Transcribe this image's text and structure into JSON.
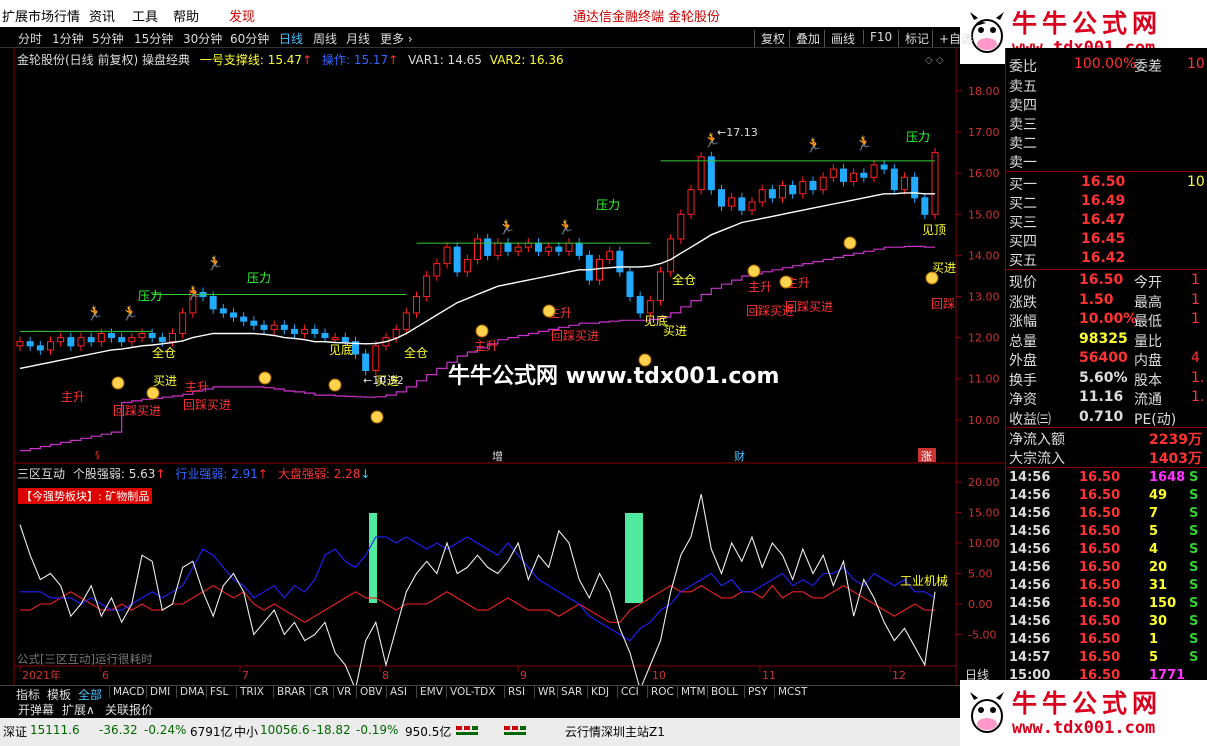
{
  "menu": {
    "items": [
      "扩展市场行情",
      "资讯",
      "工具",
      "帮助",
      "发现"
    ],
    "center1": "通达信金融终端",
    "center2": "金轮股份"
  },
  "logo": {
    "title": "牛牛公式网",
    "url": "www.tdx001.com"
  },
  "toolbar": {
    "periods": [
      "分时",
      "1分钟",
      "5分钟",
      "15分钟",
      "30分钟",
      "日线",
      "周线",
      "月线",
      "更多 ›"
    ],
    "active": "日线",
    "buttons": [
      "复权",
      "叠加",
      "画线",
      "F10",
      "标记",
      "+自选"
    ]
  },
  "main_header": {
    "title": "金轮股份(日线 前复权) 操盘经典",
    "support_label": "一号支撑线:",
    "support_value": "15.47",
    "op_label": "操作:",
    "op_value": "15.17",
    "var1": "VAR1: 14.65",
    "var2": "VAR2: 16.36"
  },
  "sub_header": {
    "title": "三区互动",
    "s1_label": "个股强弱:",
    "s1_value": "5.63",
    "s2_label": "行业强弱:",
    "s2_value": "2.91",
    "s3_label": "大盘强弱:",
    "s3_value": "2.28",
    "badge": "【今强势板块】: 矿物制品",
    "footer_note": "公式[三区互动]运行很耗时",
    "sector_label": "工业机械"
  },
  "watermark": "牛牛公式网 www.tdx001.com",
  "price_axis": [
    "18.00",
    "17.00",
    "16.00",
    "15.00",
    "14.00",
    "13.00",
    "12.00",
    "11.00",
    "10.00"
  ],
  "osc_axis": [
    "20.00",
    "15.00",
    "10.00",
    "5.00",
    "0.00",
    "-5.00"
  ],
  "time_axis": [
    "2021年",
    "6",
    "7",
    "8",
    "9",
    "10",
    "11",
    "12"
  ],
  "period_tag": "日线",
  "markers": {
    "zeng": "增",
    "cai": "财",
    "zhang": "涨",
    "peak": "17.13",
    "low": "10.52"
  },
  "chart_labels": [
    {
      "t": "压力",
      "c": "#3f3"
    },
    {
      "t": "压力",
      "c": "#3f3"
    },
    {
      "t": "压力",
      "c": "#3f3"
    },
    {
      "t": "压力",
      "c": "#3f3"
    },
    {
      "t": "全仓",
      "c": "#ff3"
    },
    {
      "t": "全仓",
      "c": "#ff3"
    },
    {
      "t": "全仓",
      "c": "#ff3"
    },
    {
      "t": "见底",
      "c": "#ff3"
    },
    {
      "t": "见底",
      "c": "#ff3"
    },
    {
      "t": "买进",
      "c": "#ff3"
    },
    {
      "t": "买进",
      "c": "#ff3"
    },
    {
      "t": "买进",
      "c": "#ff3"
    },
    {
      "t": "买进",
      "c": "#ff3"
    },
    {
      "t": "主升",
      "c": "#f33"
    },
    {
      "t": "主升",
      "c": "#f33"
    },
    {
      "t": "主升",
      "c": "#f33"
    },
    {
      "t": "主升",
      "c": "#f33"
    },
    {
      "t": "主升",
      "c": "#f33"
    },
    {
      "t": "主升",
      "c": "#f33"
    },
    {
      "t": "回踩买进",
      "c": "#f33"
    },
    {
      "t": "回踩买进",
      "c": "#f33"
    },
    {
      "t": "回踩买进",
      "c": "#f33"
    },
    {
      "t": "回踩买进",
      "c": "#f33"
    },
    {
      "t": "回踩买进",
      "c": "#f33"
    },
    {
      "t": "回踩",
      "c": "#f33"
    },
    {
      "t": "见顶",
      "c": "#ff3"
    }
  ],
  "quote": {
    "top": {
      "a": "委比",
      "b": "100.00%",
      "c": "委差",
      "d": "10"
    },
    "sells": [
      "卖五",
      "卖四",
      "卖三",
      "卖二",
      "卖一"
    ],
    "buys": [
      {
        "n": "买一",
        "p": "16.50",
        "v": "10"
      },
      {
        "n": "买二",
        "p": "16.49",
        "v": ""
      },
      {
        "n": "买三",
        "p": "16.47",
        "v": ""
      },
      {
        "n": "买四",
        "p": "16.45",
        "v": ""
      },
      {
        "n": "买五",
        "p": "16.42",
        "v": ""
      }
    ],
    "stats": [
      {
        "a": "现价",
        "b": "16.50",
        "c": "今开",
        "d": "1",
        "bc": "#f33"
      },
      {
        "a": "涨跌",
        "b": "1.50",
        "c": "最高",
        "d": "1",
        "bc": "#f33"
      },
      {
        "a": "涨幅",
        "b": "10.00%",
        "c": "最低",
        "d": "1",
        "bc": "#f33"
      },
      {
        "a": "总量",
        "b": "98325",
        "c": "量比",
        "d": "",
        "bc": "#ff3"
      },
      {
        "a": "外盘",
        "b": "56400",
        "c": "内盘",
        "d": "4",
        "bc": "#f33"
      },
      {
        "a": "换手",
        "b": "5.60%",
        "c": "股本",
        "d": "1.",
        "bc": "#ddd"
      },
      {
        "a": "净资",
        "b": "11.16",
        "c": "流通",
        "d": "1.",
        "bc": "#ddd"
      },
      {
        "a": "收益㈢",
        "b": "0.710",
        "c": "PE(动)",
        "d": "",
        "bc": "#ddd"
      }
    ],
    "flow": [
      {
        "a": "净流入额",
        "b": "2239万"
      },
      {
        "a": "大宗流入",
        "b": "1403万"
      }
    ],
    "ticks": [
      {
        "t": "14:56",
        "p": "16.50",
        "v": "1648",
        "s": "S",
        "vc": "#f3f"
      },
      {
        "t": "14:56",
        "p": "16.50",
        "v": "49",
        "s": "S",
        "vc": "#ff3"
      },
      {
        "t": "14:56",
        "p": "16.50",
        "v": "7",
        "s": "S",
        "vc": "#ff3"
      },
      {
        "t": "14:56",
        "p": "16.50",
        "v": "5",
        "s": "S",
        "vc": "#ff3"
      },
      {
        "t": "14:56",
        "p": "16.50",
        "v": "4",
        "s": "S",
        "vc": "#ff3"
      },
      {
        "t": "14:56",
        "p": "16.50",
        "v": "20",
        "s": "S",
        "vc": "#ff3"
      },
      {
        "t": "14:56",
        "p": "16.50",
        "v": "31",
        "s": "S",
        "vc": "#ff3"
      },
      {
        "t": "14:56",
        "p": "16.50",
        "v": "150",
        "s": "S",
        "vc": "#ff3"
      },
      {
        "t": "14:56",
        "p": "16.50",
        "v": "30",
        "s": "S",
        "vc": "#ff3"
      },
      {
        "t": "14:56",
        "p": "16.50",
        "v": "1",
        "s": "S",
        "vc": "#ff3"
      },
      {
        "t": "14:57",
        "p": "16.50",
        "v": "5",
        "s": "S",
        "vc": "#ff3"
      },
      {
        "t": "15:00",
        "p": "16.50",
        "v": "1771",
        "s": "",
        "vc": "#f3f"
      }
    ]
  },
  "indicators": {
    "tabs": [
      "指标",
      "模板",
      "全部"
    ],
    "list": [
      "MACD",
      "DMI",
      "DMA",
      "FSL",
      "TRIX",
      "BRAR",
      "CR",
      "VR",
      "OBV",
      "ASI",
      "EMV",
      "VOL-TDX",
      "RSI",
      "WR",
      "SAR",
      "KDJ",
      "CCI",
      "ROC",
      "MTM",
      "BOLL",
      "PSY",
      "MCST"
    ]
  },
  "bottom_tabs": [
    "开弹幕",
    "扩展∧",
    "关联报价"
  ],
  "status": {
    "i1": "深证",
    "v1": "15111.6",
    "c1": "-36.32",
    "p1": "-0.24%",
    "a1": "6791亿",
    "i2": "中小",
    "v2": "10056.6",
    "c2": "-18.82",
    "p2": "-0.19%",
    "a2": "950.5亿",
    "server": "云行情深圳主站Z1"
  },
  "chart_data": {
    "type": "candlestick",
    "ylim": [
      9.6,
      18.4
    ],
    "close": [
      11.9,
      11.8,
      11.7,
      11.9,
      12.0,
      11.8,
      12.0,
      11.9,
      12.1,
      12.0,
      11.9,
      12.0,
      12.1,
      12.0,
      11.9,
      12.1,
      12.6,
      13.1,
      13.0,
      12.7,
      12.6,
      12.5,
      12.4,
      12.3,
      12.2,
      12.3,
      12.2,
      12.1,
      12.2,
      12.1,
      12.0,
      12.0,
      11.9,
      11.6,
      11.2,
      11.8,
      12.0,
      12.2,
      12.6,
      13.0,
      13.5,
      13.8,
      14.2,
      13.6,
      13.9,
      14.4,
      14.0,
      14.3,
      14.1,
      14.2,
      14.3,
      14.1,
      14.2,
      14.1,
      14.3,
      14.0,
      13.4,
      13.9,
      14.1,
      13.6,
      13.0,
      12.6,
      12.9,
      13.6,
      14.4,
      15.0,
      15.6,
      16.4,
      15.6,
      15.2,
      15.4,
      15.1,
      15.3,
      15.6,
      15.4,
      15.7,
      15.5,
      15.8,
      15.6,
      15.9,
      16.1,
      15.8,
      16.0,
      15.9,
      16.2,
      16.1,
      15.6,
      15.9,
      15.4,
      15.0,
      16.5
    ],
    "ma": [
      11.25,
      11.3,
      11.35,
      11.4,
      11.45,
      11.5,
      11.55,
      11.6,
      11.65,
      11.7,
      11.72,
      11.76,
      11.8,
      11.82,
      11.85,
      11.88,
      11.92,
      12.0,
      12.05,
      12.1,
      12.1,
      12.1,
      12.1,
      12.1,
      12.08,
      12.05,
      12.0,
      11.98,
      11.95,
      11.9,
      11.9,
      11.88,
      11.87,
      11.86,
      11.85,
      11.86,
      11.9,
      11.98,
      12.1,
      12.25,
      12.4,
      12.55,
      12.7,
      12.85,
      12.95,
      13.05,
      13.15,
      13.25,
      13.3,
      13.35,
      13.4,
      13.45,
      13.5,
      13.55,
      13.6,
      13.65,
      13.65,
      13.68,
      13.7,
      13.72,
      13.72,
      13.72,
      13.74,
      13.8,
      13.9,
      14.05,
      14.2,
      14.35,
      14.5,
      14.6,
      14.7,
      14.8,
      14.85,
      14.9,
      14.95,
      15.0,
      15.05,
      15.1,
      15.15,
      15.2,
      15.25,
      15.3,
      15.35,
      15.4,
      15.45,
      15.5,
      15.5,
      15.52,
      15.52,
      15.5,
      15.5
    ],
    "osc_white": [
      13,
      8,
      4,
      5,
      3,
      -2,
      0,
      3,
      -2,
      1,
      -3,
      0,
      8,
      7,
      -1,
      0,
      6,
      7,
      2,
      -2,
      3,
      5,
      2,
      -5,
      -3,
      -1,
      -5,
      -3,
      -6,
      -5,
      -3,
      -8,
      -10,
      -14,
      -6,
      -3,
      -10,
      -4,
      2,
      5,
      7,
      5,
      10,
      5,
      6,
      8,
      6,
      5,
      7,
      10,
      4,
      8,
      6,
      12,
      10,
      4,
      1,
      5,
      2,
      -4,
      -8,
      -14,
      -10,
      -6,
      2,
      8,
      11,
      18,
      9,
      5,
      10,
      7,
      11,
      6,
      10,
      8,
      4,
      9,
      5,
      8,
      3,
      7,
      -2,
      4,
      1,
      -3,
      -6,
      -4,
      -7,
      -10,
      2
    ],
    "osc_blue": [
      2,
      2,
      2,
      1,
      1,
      1,
      0,
      1,
      0,
      -1,
      -1,
      0,
      1,
      2,
      1,
      2,
      3,
      6,
      9,
      8,
      6,
      4,
      3,
      1,
      2,
      3,
      1,
      3,
      2,
      4,
      8,
      9,
      7,
      6,
      8,
      11,
      11,
      10,
      11,
      10,
      9,
      10,
      9,
      10,
      11,
      10,
      9,
      8,
      10,
      8,
      6,
      4,
      3,
      2,
      1,
      0,
      -2,
      -3,
      -4,
      -5,
      -6,
      -4,
      -3,
      -1,
      0,
      2,
      3,
      4,
      5,
      3,
      4,
      2,
      2,
      3,
      4,
      5,
      3,
      4,
      3,
      5,
      5,
      6,
      4,
      3,
      5,
      4,
      3,
      4,
      2,
      2,
      1
    ],
    "osc_red": [
      -1,
      -1,
      0,
      0,
      1,
      2,
      1,
      0,
      -1,
      -1,
      0,
      -1,
      0,
      -1,
      -1,
      0,
      0,
      1,
      2,
      3,
      2,
      1,
      2,
      0,
      -1,
      0,
      -1,
      -2,
      -3,
      -2,
      -1,
      0,
      1,
      2,
      1,
      1,
      0,
      -1,
      0,
      0,
      0,
      1,
      2,
      1,
      0,
      -1,
      -1,
      0,
      1,
      0,
      -1,
      -1,
      -1,
      -2,
      -1,
      0,
      -1,
      -2,
      -3,
      -3,
      -1,
      0,
      1,
      2,
      3,
      2,
      2,
      3,
      2,
      1,
      1,
      2,
      2,
      1,
      3,
      1,
      2,
      2,
      1,
      1,
      2,
      3,
      2,
      1,
      0,
      -1,
      -2,
      -1,
      0,
      -1,
      -1
    ]
  }
}
